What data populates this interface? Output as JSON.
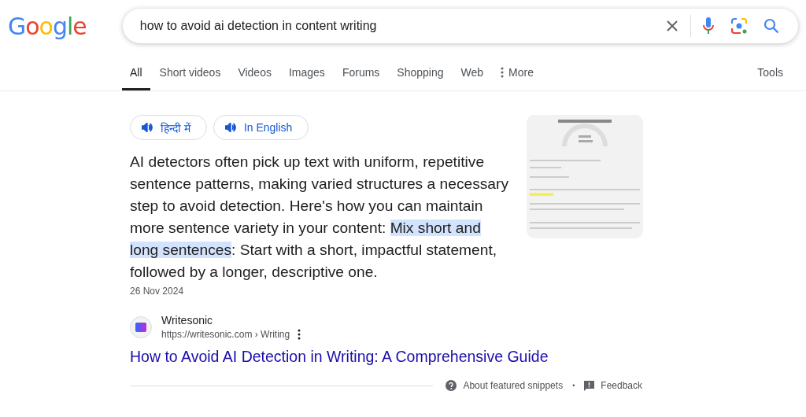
{
  "logo": {
    "letters": [
      {
        "char": "G",
        "color": "#4285f4"
      },
      {
        "char": "o",
        "color": "#ea4335"
      },
      {
        "char": "o",
        "color": "#fbbc05"
      },
      {
        "char": "g",
        "color": "#4285f4"
      },
      {
        "char": "l",
        "color": "#34a853"
      },
      {
        "char": "e",
        "color": "#ea4335"
      }
    ]
  },
  "search": {
    "value": "how to avoid ai detection in content writing"
  },
  "tabs": [
    {
      "label": "All",
      "selected": true,
      "kind": "tab"
    },
    {
      "label": "Short videos",
      "selected": false,
      "kind": "tab"
    },
    {
      "label": "Videos",
      "selected": false,
      "kind": "tab"
    },
    {
      "label": "Images",
      "selected": false,
      "kind": "tab"
    },
    {
      "label": "Forums",
      "selected": false,
      "kind": "tab"
    },
    {
      "label": "Shopping",
      "selected": false,
      "kind": "tab"
    },
    {
      "label": "Web",
      "selected": false,
      "kind": "tab"
    },
    {
      "label": "More",
      "selected": false,
      "kind": "more"
    }
  ],
  "tools": "Tools",
  "listen_buttons": [
    "हिन्दी में",
    "In English"
  ],
  "snippet": {
    "segments": [
      {
        "text": "AI detectors often pick up text with uniform, repetitive sentence patterns, making varied structures a necessary step to avoid detection. Here's how you can maintain more sentence variety in your content: ",
        "highlighted": false
      },
      {
        "text": "Mix short and long sentences",
        "highlighted": true
      },
      {
        "text": ": Start with a short, impactful statement, followed by a longer, descriptive one.",
        "highlighted": false
      }
    ],
    "date": "26 Nov 2024"
  },
  "source": {
    "name": "Writesonic",
    "url": "https://writesonic.com › Writing",
    "title": "How to Avoid AI Detection in Writing: A Comprehensive Guide"
  },
  "footer": {
    "about": "About featured snippets",
    "separator": "•",
    "feedback": "Feedback"
  }
}
